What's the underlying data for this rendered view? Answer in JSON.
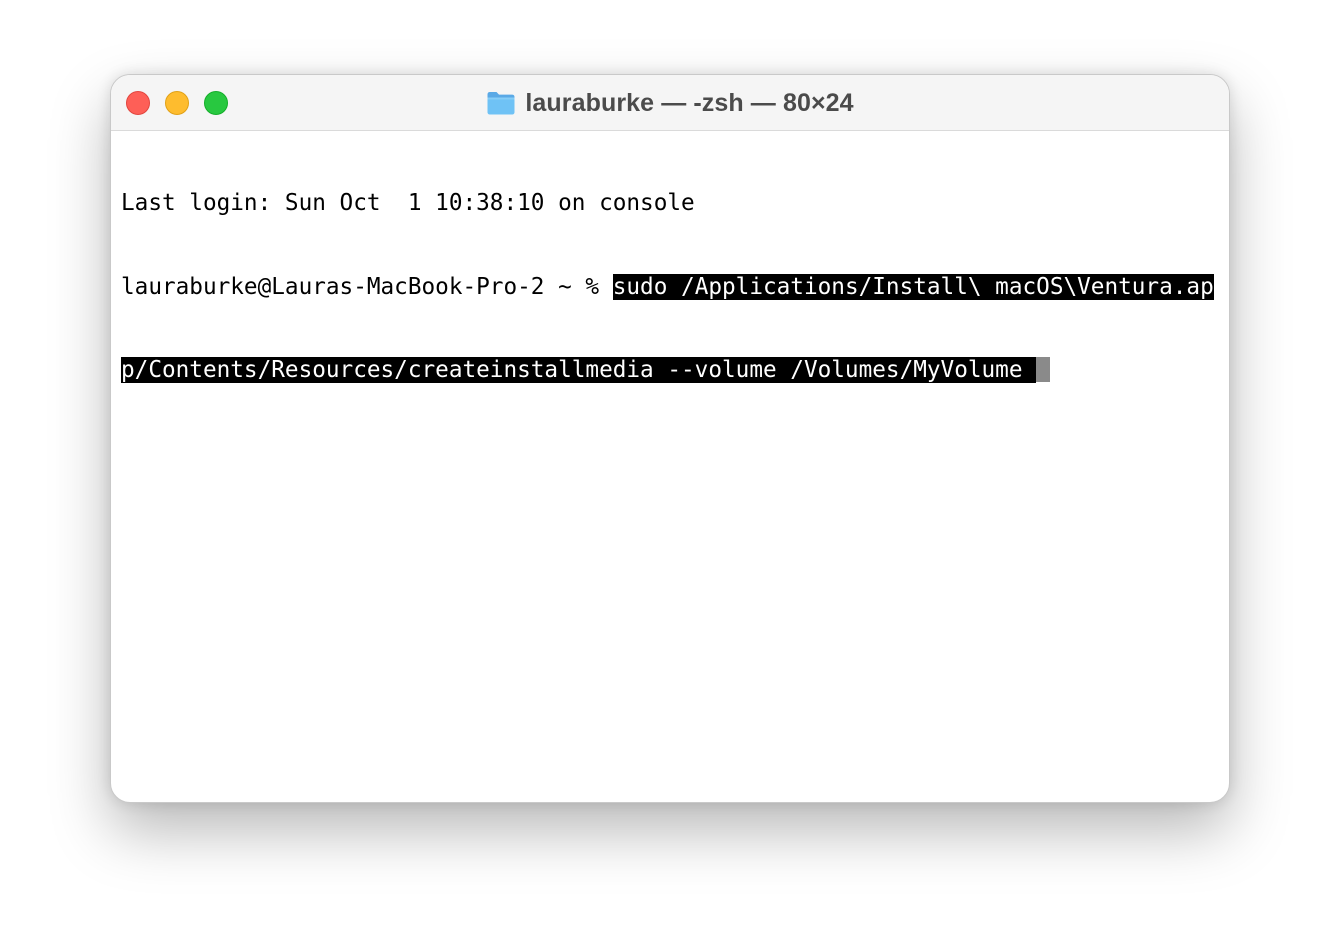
{
  "window": {
    "title": "lauraburke — -zsh — 80×24",
    "title_icon": "folder-icon",
    "traffic_lights": {
      "close_color": "#fe5f57",
      "minimize_color": "#febc2e",
      "zoom_color": "#28c840"
    }
  },
  "terminal": {
    "last_login": "Last login: Sun Oct  1 10:38:10 on console",
    "prompt": "lauraburke@Lauras-MacBook-Pro-2 ~ % ",
    "command_line1": "sudo /Applications/Install\\ macOS\\Ventura.ap",
    "command_line2": "p/Contents/Resources/createinstallmedia --volume /Volumes/MyVolume ",
    "selection_color": "#000000",
    "cursor_color": "#8a8a8a"
  }
}
